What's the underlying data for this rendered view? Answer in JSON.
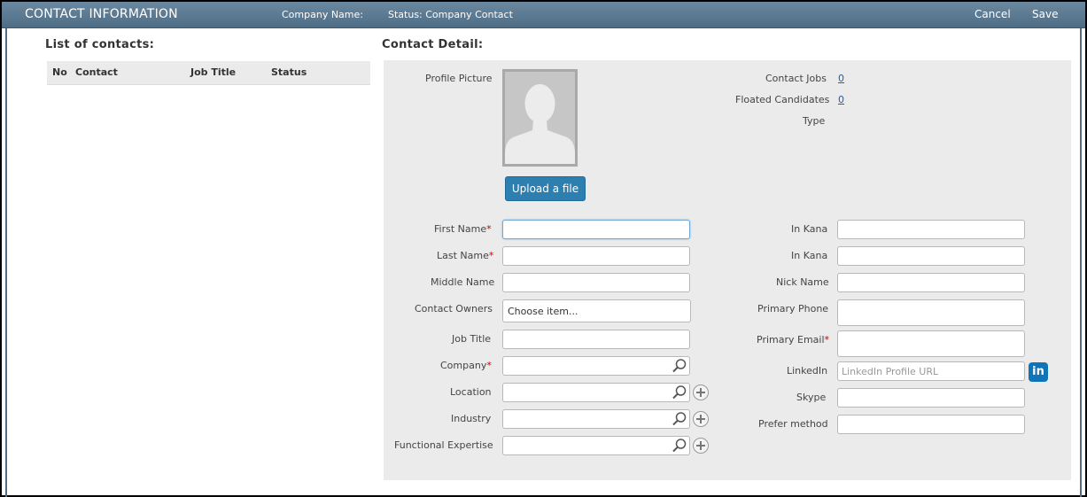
{
  "header": {
    "title": "CONTACT INFORMATION",
    "company_name": "Company Name:",
    "status": "Status: Company Contact",
    "cancel": "Cancel",
    "save": "Save"
  },
  "list": {
    "title": "List of contacts:",
    "columns": [
      "No",
      "Contact",
      "Job Title",
      "Status"
    ]
  },
  "detail": {
    "title": "Contact Detail:",
    "profile_picture": "Profile Picture",
    "upload": "Upload a file",
    "contact_jobs_label": "Contact Jobs",
    "contact_jobs_value": "0",
    "floated_label": "Floated Candidates",
    "floated_value": "0",
    "type_label": "Type",
    "fields": {
      "first_name": "First Name",
      "last_name": "Last Name",
      "middle_name": "Middle Name",
      "contact_owners": "Contact Owners",
      "contact_owners_value": "Choose item...",
      "job_title": "Job Title",
      "company": "Company",
      "location": "Location",
      "industry": "Industry",
      "functional_expertise": "Functional Expertise",
      "in_kana_1": "In Kana",
      "in_kana_2": "In Kana",
      "nick_name": "Nick Name",
      "primary_phone": "Primary Phone",
      "primary_email": "Primary Email",
      "linkedin": "LinkedIn",
      "linkedin_placeholder": "LinkedIn Profile URL",
      "skype": "Skype",
      "prefer_method": "Prefer method",
      "required_mark": "*"
    },
    "linkedin_logo": "in"
  }
}
